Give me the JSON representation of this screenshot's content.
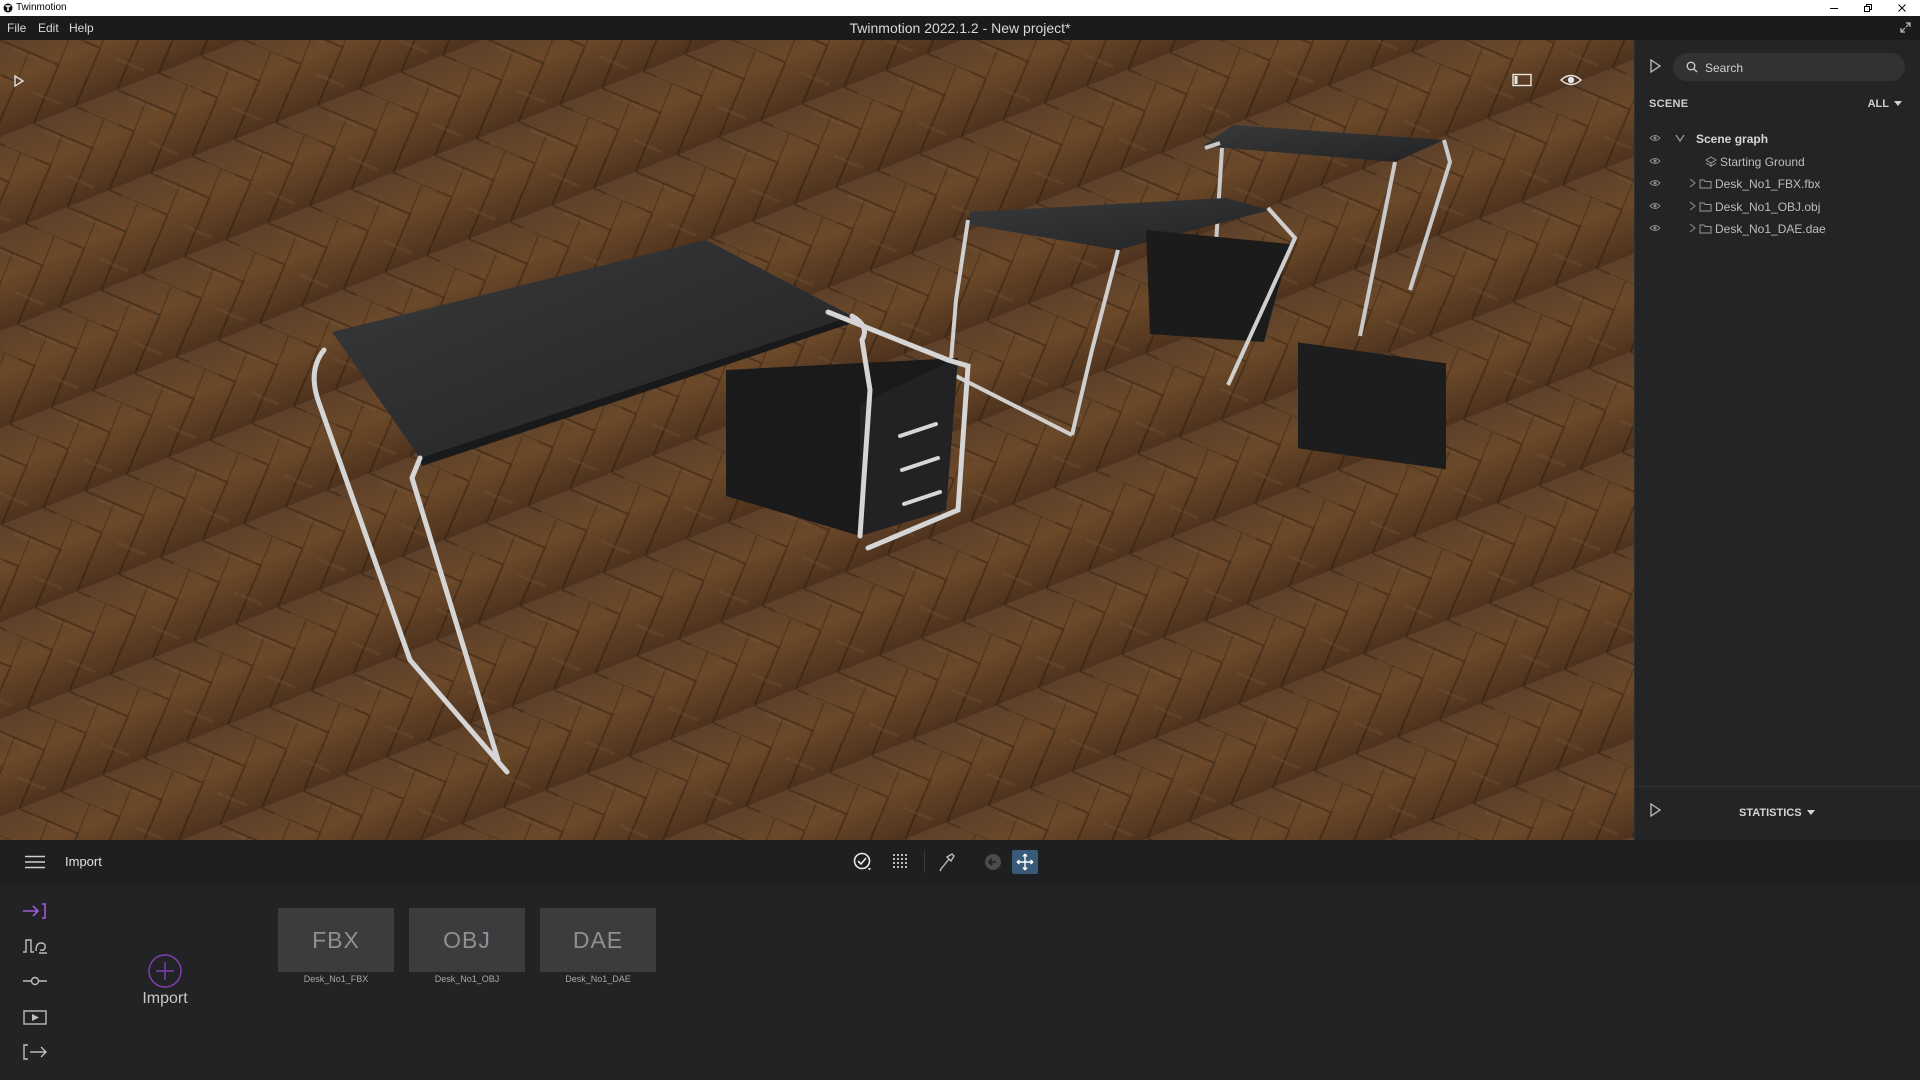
{
  "window": {
    "app_name": "Twinmotion",
    "title": "Twinmotion 2022.1.2 - New project*",
    "controls": [
      "minimize-icon",
      "restore-icon",
      "close-icon"
    ]
  },
  "menu": {
    "items": [
      "File",
      "Edit",
      "Help"
    ]
  },
  "viewport": {
    "icons": [
      "play-icon",
      "frame-icon",
      "eye-icon"
    ]
  },
  "scene_panel": {
    "search_placeholder": "Search",
    "section_label": "SCENE",
    "filter_value": "ALL",
    "tree": [
      {
        "label": "Scene graph",
        "icon": "chevron-down-icon",
        "root": true
      },
      {
        "label": "Starting Ground",
        "icon": "ground-icon"
      },
      {
        "label": "Desk_No1_FBX.fbx",
        "icon": "folder-icon",
        "collapsed": true
      },
      {
        "label": "Desk_No1_OBJ.obj",
        "icon": "folder-icon",
        "collapsed": true
      },
      {
        "label": "Desk_No1_DAE.dae",
        "icon": "folder-icon",
        "collapsed": true
      }
    ],
    "statistics_label": "STATISTICS"
  },
  "toolbar": {
    "mode_title": "Import",
    "tools": [
      "select-icon",
      "grid-snap-icon",
      "eyedropper-icon",
      "back-icon",
      "move-icon"
    ],
    "active_tool": "move-icon"
  },
  "import_panel": {
    "side_tabs": [
      "import-tab-icon",
      "context-tab-icon",
      "configure-tab-icon",
      "media-tab-icon",
      "export-tab-icon"
    ],
    "active_tab": "import-tab-icon",
    "accent_color": "#a15ad6",
    "import_label": "Import",
    "assets": [
      {
        "format": "FBX",
        "name": "Desk_No1_FBX"
      },
      {
        "format": "OBJ",
        "name": "Desk_No1_OBJ"
      },
      {
        "format": "DAE",
        "name": "Desk_No1_DAE"
      }
    ]
  }
}
